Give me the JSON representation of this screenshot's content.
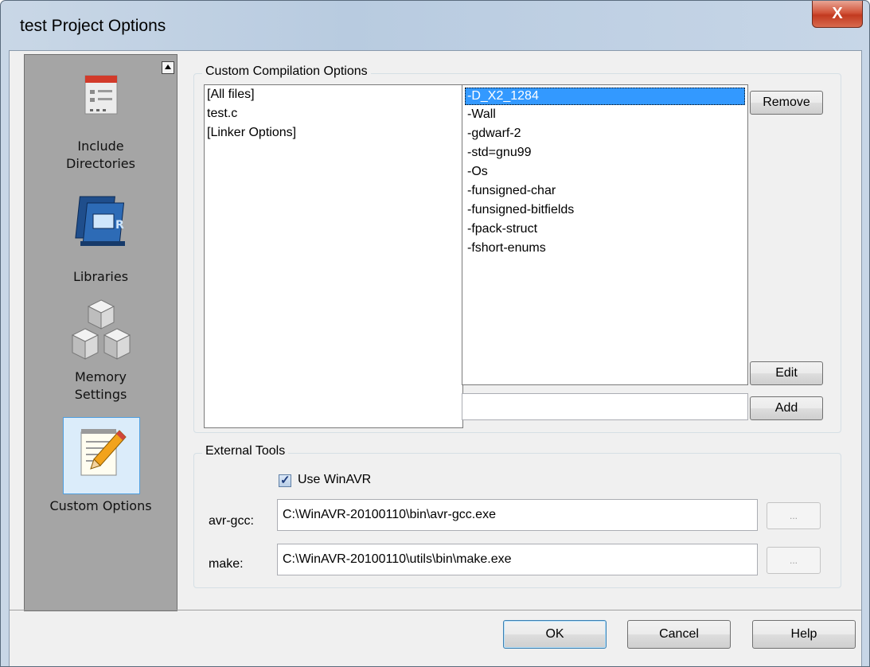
{
  "window": {
    "title": "test Project Options",
    "close_label": "X"
  },
  "sidebar": {
    "items": [
      {
        "label_line1": "Include",
        "label_line2": "Directories",
        "icon": "folder-list-icon"
      },
      {
        "label_line1": "Libraries",
        "icon": "books-icon"
      },
      {
        "label_line1": "Memory",
        "label_line2": "Settings",
        "icon": "cubes-icon"
      },
      {
        "label_line1": "Custom Options",
        "icon": "notepad-pencil-icon"
      }
    ]
  },
  "custom_compilation": {
    "group_label": "Custom Compilation Options",
    "files": [
      "[All files]",
      "test.c",
      "[Linker Options]"
    ],
    "options": [
      "-D_X2_1284",
      "-Wall",
      "-gdwarf-2",
      "-std=gnu99",
      "-Os",
      "-funsigned-char",
      "-funsigned-bitfields",
      "-fpack-struct",
      "-fshort-enums"
    ],
    "selected_option_index": 0,
    "new_option_value": "",
    "remove_label": "Remove",
    "edit_label": "Edit",
    "add_label": "Add"
  },
  "external_tools": {
    "group_label": "External Tools",
    "use_winavr_label": "Use WinAVR",
    "use_winavr_checked": true,
    "avr_gcc_label": "avr-gcc:",
    "avr_gcc_value": "C:\\WinAVR-20100110\\bin\\avr-gcc.exe",
    "make_label": "make:",
    "make_value": "C:\\WinAVR-20100110\\utils\\bin\\make.exe",
    "browse_label": "..."
  },
  "footer": {
    "ok_label": "OK",
    "cancel_label": "Cancel",
    "help_label": "Help"
  }
}
